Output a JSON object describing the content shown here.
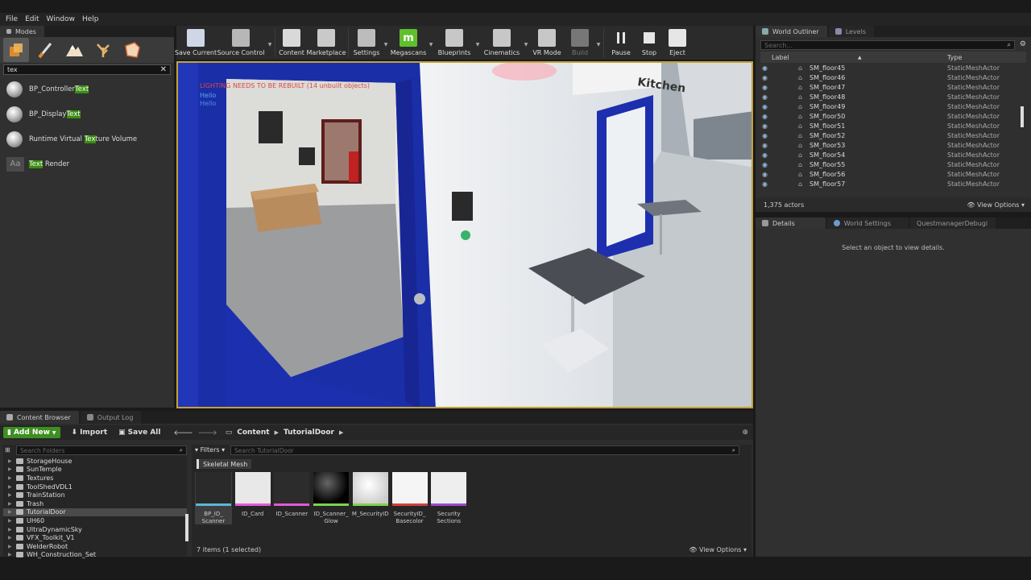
{
  "menu": [
    "File",
    "Edit",
    "Window",
    "Help"
  ],
  "modes": {
    "tab": "Modes",
    "search_value": "tex",
    "items": [
      {
        "pre": "BP_Controller",
        "match": "Text",
        "post": "",
        "icon": "sphere-icon"
      },
      {
        "pre": "BP_Display",
        "match": "Text",
        "post": "",
        "icon": "sphere-icon"
      },
      {
        "pre": "Runtime Virtual ",
        "match": "Tex",
        "post": "ture Volume",
        "icon": "sphere-icon"
      },
      {
        "pre": "",
        "match": "Text",
        "post": " Render",
        "icon": "text-render-icon"
      }
    ]
  },
  "toolbar": [
    {
      "label": "Save Current",
      "icon": "save-icon",
      "color": "#cfd6e6"
    },
    {
      "label": "Source Control",
      "icon": "source-control-icon",
      "color": "#b7b7b7"
    },
    {
      "label": "Content",
      "icon": "content-icon",
      "color": "#d9d9d9"
    },
    {
      "label": "Marketplace",
      "icon": "marketplace-icon",
      "color": "#c9c9c9"
    },
    {
      "label": "Settings",
      "icon": "settings-icon",
      "color": "#bcbcbc"
    },
    {
      "label": "Megascans",
      "icon": "megascans-icon",
      "color": "#5fbf2c"
    },
    {
      "label": "Blueprints",
      "icon": "blueprints-icon",
      "color": "#c7c7c7"
    },
    {
      "label": "Cinematics",
      "icon": "cinematics-icon",
      "color": "#c7c7c7"
    },
    {
      "label": "VR Mode",
      "icon": "vr-mode-icon",
      "color": "#c7c7c7"
    },
    {
      "label": "Build",
      "icon": "build-icon",
      "color": "#777777"
    },
    {
      "label": "Pause",
      "icon": "pause-icon",
      "color": "#e6e6e6"
    },
    {
      "label": "Stop",
      "icon": "stop-icon",
      "color": "#e6e6e6"
    },
    {
      "label": "Eject",
      "icon": "eject-icon",
      "color": "#e6e6e6"
    }
  ],
  "viewport": {
    "warning": "LIGHTING NEEDS TO BE REBUILT (14 unbuilt objects)",
    "hello1": "Hello",
    "hello2": "Hello",
    "sign": "Kitchen"
  },
  "outliner": {
    "tab1": "World Outliner",
    "tab2": "Levels",
    "search_placeholder": "Search...",
    "col_label": "Label",
    "col_type": "Type",
    "rows": [
      {
        "name": "SM_floor45",
        "type": "StaticMeshActor"
      },
      {
        "name": "SM_floor46",
        "type": "StaticMeshActor"
      },
      {
        "name": "SM_floor47",
        "type": "StaticMeshActor"
      },
      {
        "name": "SM_floor48",
        "type": "StaticMeshActor"
      },
      {
        "name": "SM_floor49",
        "type": "StaticMeshActor"
      },
      {
        "name": "SM_floor50",
        "type": "StaticMeshActor"
      },
      {
        "name": "SM_floor51",
        "type": "StaticMeshActor"
      },
      {
        "name": "SM_floor52",
        "type": "StaticMeshActor"
      },
      {
        "name": "SM_floor53",
        "type": "StaticMeshActor"
      },
      {
        "name": "SM_floor54",
        "type": "StaticMeshActor"
      },
      {
        "name": "SM_floor55",
        "type": "StaticMeshActor"
      },
      {
        "name": "SM_floor56",
        "type": "StaticMeshActor"
      },
      {
        "name": "SM_floor57",
        "type": "StaticMeshActor"
      }
    ],
    "actor_count": "1,375 actors",
    "view_options": "View Options"
  },
  "details": {
    "tab1": "Details",
    "tab2": "World Settings",
    "tab3": "QuestmanagerDebugi",
    "message": "Select an object to view details."
  },
  "content_browser": {
    "tab1": "Content Browser",
    "tab2": "Output Log",
    "add_new": "Add New",
    "import": "Import",
    "save_all": "Save All",
    "crumb1": "Content",
    "crumb2": "TutorialDoor",
    "folder_search": "Search Folders",
    "asset_search": "Search TutorialDoor",
    "filters": "Filters",
    "filter_chip": "Skeletal Mesh",
    "folders": [
      "StorageHouse",
      "SunTemple",
      "Textures",
      "ToolShedVDL1",
      "TrainStation",
      "Trash",
      "TutorialDoor",
      "UH60",
      "UltraDynamicSky",
      "VFX_Toolkit_V1",
      "WelderRobot",
      "WH_Construction_Set"
    ],
    "selected_folder": "TutorialDoor",
    "assets": [
      {
        "caption": "BP_ID_\nScanner",
        "color": "#5bb7d6"
      },
      {
        "caption": "ID_Card",
        "color": "#e05ad6"
      },
      {
        "caption": "ID_Scanner",
        "color": "#e05ad6"
      },
      {
        "caption": "ID_Scanner_\nGlow",
        "color": "#7fd34a"
      },
      {
        "caption": "M_SecurityID",
        "color": "#7fd34a"
      },
      {
        "caption": "SecurityID_\nBasecolor",
        "color": "#d04040"
      },
      {
        "caption": "Security\nSections",
        "color": "#9a4ad0"
      }
    ],
    "status": "7 items (1 selected)",
    "view_options": "View Options"
  }
}
